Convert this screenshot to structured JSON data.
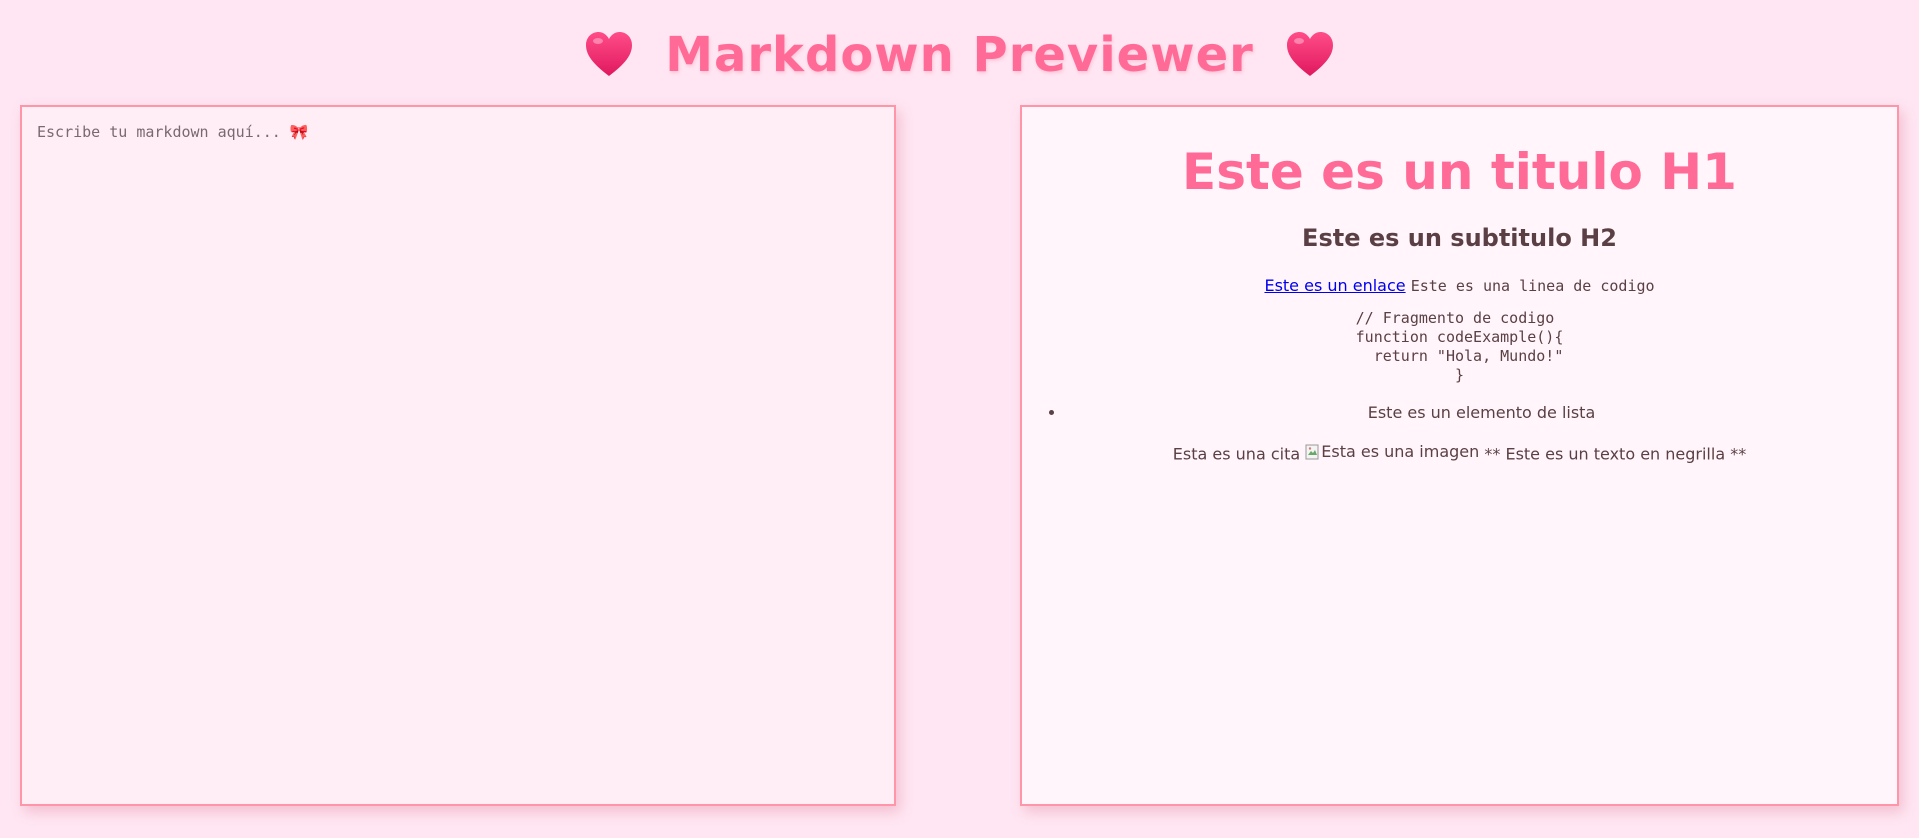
{
  "header": {
    "title": "Markdown Previewer",
    "left_icon": "heart-icon",
    "right_icon": "heart-icon"
  },
  "editor": {
    "placeholder": "Escribe tu markdown aquí... 🎀",
    "value": ""
  },
  "preview": {
    "h1": "Este es un titulo H1",
    "h2": "Este es un subtitulo H2",
    "link_text": "Este es un enlace",
    "inline_code": "Este es una linea de codigo",
    "code_block": "// Fragmento de codigo\nfunction codeExample(){\n  return \"Hola, Mundo!\"\n           }",
    "list_item": "Este es un elemento de lista",
    "quote_text": "Esta es una cita",
    "image_alt": "Esta es una imagen",
    "bold_text": "** Este es un texto en negrilla **"
  },
  "colors": {
    "background": "#ffe6f2",
    "accent": "#ff6b96",
    "border": "#ff95a8",
    "text": "#5a3f44"
  }
}
